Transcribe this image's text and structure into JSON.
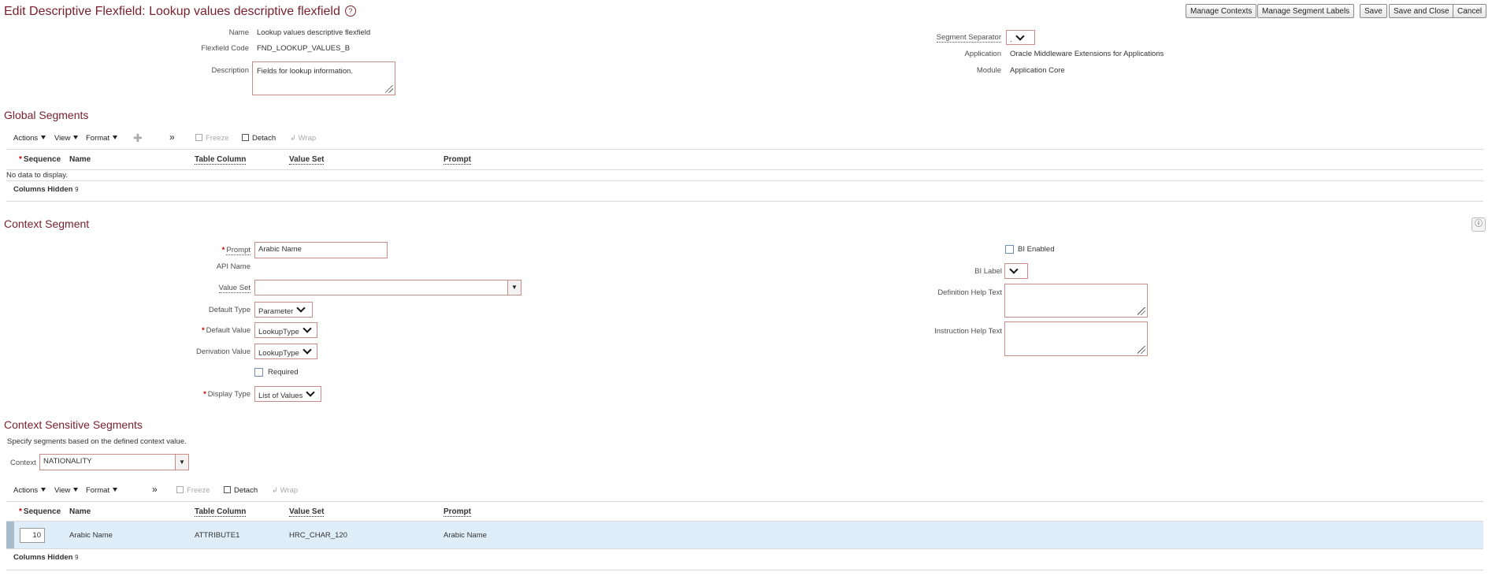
{
  "page": {
    "title": "Edit Descriptive Flexfield: Lookup values descriptive flexfield"
  },
  "buttons": {
    "manage_contexts": "Manage Contexts",
    "manage_segment_labels": "Manage Segment Labels",
    "save": "Save",
    "save_and_close": "Save and Close",
    "cancel": "Cancel"
  },
  "header": {
    "name_label": "Name",
    "name_value": "Lookup values descriptive flexfield",
    "code_label": "Flexfield Code",
    "code_value": "FND_LOOKUP_VALUES_B",
    "description_label": "Description",
    "description_value": "Fields for lookup information.",
    "separator_label": "Segment Separator",
    "separator_value": ".",
    "application_label": "Application",
    "application_value": "Oracle Middleware Extensions for Applications",
    "module_label": "Module",
    "module_value": "Application Core"
  },
  "global_segments": {
    "title": "Global Segments",
    "toolbar": {
      "actions": "Actions",
      "view": "View",
      "format": "Format",
      "freeze": "Freeze",
      "detach": "Detach",
      "wrap": "Wrap"
    },
    "columns": [
      "Sequence",
      "Name",
      "Table Column",
      "Value Set",
      "Prompt"
    ],
    "empty_text": "No data to display.",
    "columns_hidden": "Columns Hidden",
    "columns_hidden_count": "9"
  },
  "context_segment": {
    "title": "Context Segment",
    "prompt_label": "Prompt",
    "prompt_value": "Arabic Name",
    "api_name_label": "API Name",
    "value_set_label": "Value Set",
    "value_set_value": "",
    "default_type_label": "Default Type",
    "default_type_value": "Parameter",
    "default_value_label": "Default Value",
    "default_value_value": "LookupType",
    "derivation_value_label": "Derivation Value",
    "derivation_value_value": "LookupType",
    "required_label": "Required",
    "display_type_label": "Display Type",
    "display_type_value": "List of Values",
    "bi_enabled_label": "BI Enabled",
    "bi_label_label": "BI Label",
    "def_help_label": "Definition Help Text",
    "instr_help_label": "Instruction Help Text"
  },
  "context_sensitive": {
    "title": "Context Sensitive Segments",
    "instruction": "Specify segments based on the defined context value.",
    "context_label": "Context",
    "context_value": "NATIONALITY",
    "toolbar": {
      "actions": "Actions",
      "view": "View",
      "format": "Format",
      "freeze": "Freeze",
      "detach": "Detach",
      "wrap": "Wrap"
    },
    "columns": [
      "Sequence",
      "Name",
      "Table Column",
      "Value Set",
      "Prompt"
    ],
    "rows": [
      {
        "sequence": "10",
        "name": "Arabic Name",
        "table_column": "ATTRIBUTE1",
        "value_set": "HRC_CHAR_120",
        "prompt": "Arabic Name"
      }
    ],
    "columns_hidden": "Columns Hidden",
    "columns_hidden_count": "9"
  }
}
